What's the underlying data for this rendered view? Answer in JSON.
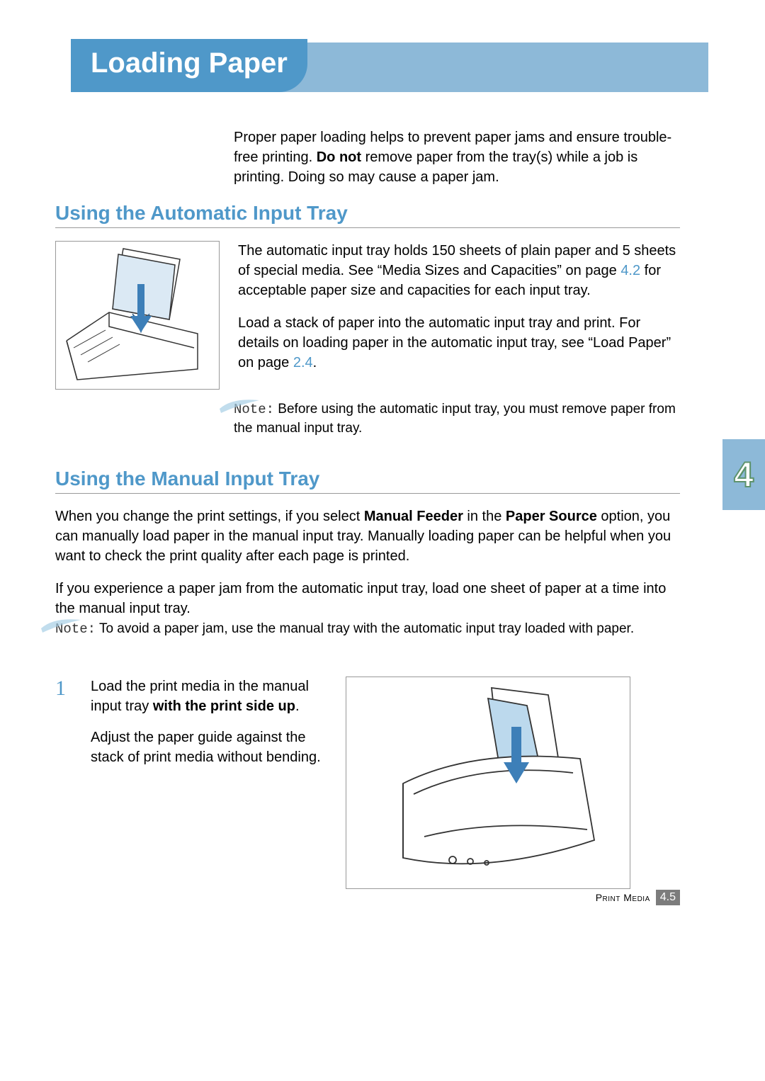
{
  "title": "Loading Paper",
  "intro": {
    "pre": "Proper paper loading helps to prevent paper jams and ensure trouble-free printing. ",
    "bold": "Do not",
    "post": " remove paper from the tray(s) while a job is printing. Doing so may cause a paper jam."
  },
  "section1": {
    "heading": "Using the Automatic Input Tray",
    "p1_pre": "The automatic input tray holds 150 sheets of plain paper and 5 sheets of special media. See “Media Sizes and Capacities” on page ",
    "p1_ref": "4.2",
    "p1_post": " for acceptable paper size and capacities for each input tray.",
    "p2_pre": "Load a stack of paper into the automatic input tray and print. For details on loading paper in the automatic input tray, see “Load Paper” on page ",
    "p2_ref": "2.4",
    "p2_post": ".",
    "note_label": "Note:",
    "note_text": " Before using the automatic input tray, you must remove paper from the manual input tray."
  },
  "section2": {
    "heading": "Using the Manual Input Tray",
    "p1_pre": "When you change the print settings, if you select ",
    "p1_bold1": "Manual Feeder",
    "p1_mid": " in the ",
    "p1_bold2": "Paper Source",
    "p1_post": " option, you can manually load paper in the manual input tray. Manually loading paper can be helpful when you want to check the print quality after each page is printed.",
    "p2": "If you experience a paper jam from the automatic input tray, load one sheet of paper at a time into the manual input tray.",
    "note_label": "Note:",
    "note_text": " To avoid a paper jam, use the manual tray with the automatic input tray loaded with paper."
  },
  "step1": {
    "number": "1",
    "p1_pre": "Load the print media in the manual input tray ",
    "p1_bold": "with the print side up",
    "p1_post": ".",
    "p2": "Adjust the paper guide against the stack of print media without bending."
  },
  "side_tab": "4",
  "footer": {
    "label": "Print Media",
    "page": "4.5"
  }
}
